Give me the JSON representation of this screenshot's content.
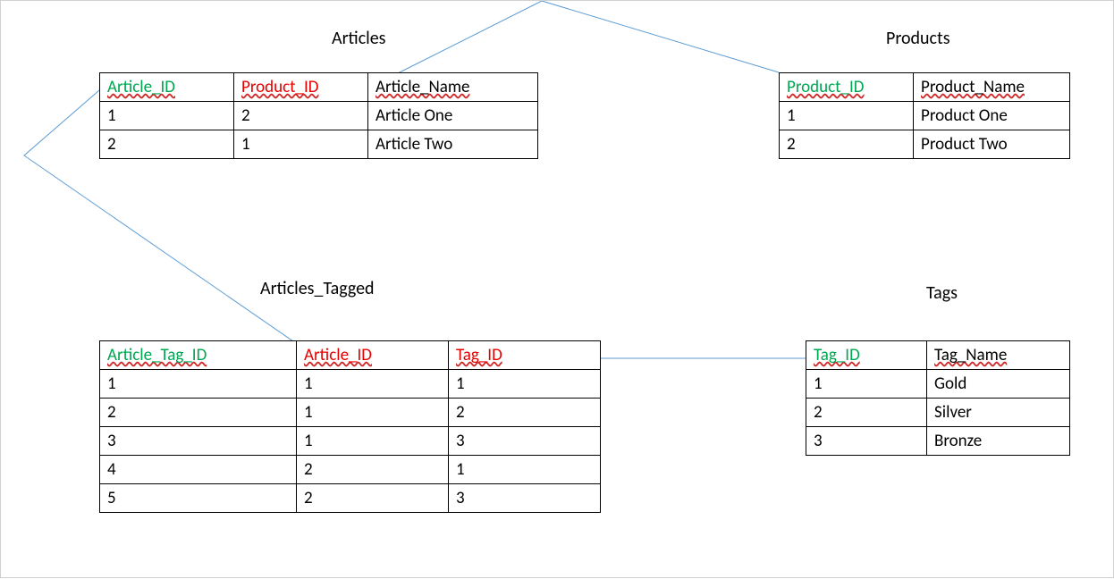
{
  "tables": {
    "articles": {
      "title": "Articles",
      "columns": [
        "Article_ID",
        "Product_ID",
        "Article_Name"
      ],
      "col_roles": [
        "pk",
        "fk",
        "plain_u"
      ],
      "rows": [
        [
          "1",
          "2",
          "Article One"
        ],
        [
          "2",
          "1",
          "Article Two"
        ]
      ]
    },
    "products": {
      "title": "Products",
      "columns": [
        "Product_ID",
        "Product_Name"
      ],
      "col_roles": [
        "pk",
        "plain_u"
      ],
      "rows": [
        [
          "1",
          "Product One"
        ],
        [
          "2",
          "Product Two"
        ]
      ]
    },
    "articles_tagged": {
      "title": "Articles_Tagged",
      "columns": [
        "Article_Tag_ID",
        "Article_ID",
        "Tag_ID"
      ],
      "col_roles": [
        "pk",
        "fk",
        "fk"
      ],
      "rows": [
        [
          "1",
          "1",
          "1"
        ],
        [
          "2",
          "1",
          "2"
        ],
        [
          "3",
          "1",
          "3"
        ],
        [
          "4",
          "2",
          "1"
        ],
        [
          "5",
          "2",
          "3"
        ]
      ]
    },
    "tags": {
      "title": "Tags",
      "columns": [
        "Tag_ID",
        "Tag_Name"
      ],
      "col_roles": [
        "pk",
        "plain_u"
      ],
      "rows": [
        [
          "1",
          "Gold"
        ],
        [
          "2",
          "Silver"
        ],
        [
          "3",
          "Bronze"
        ]
      ]
    }
  },
  "relationships": [
    {
      "from_table": "Articles",
      "from_col": "Product_ID",
      "to_table": "Products",
      "to_col": "Product_ID"
    },
    {
      "from_table": "Articles_Tagged",
      "from_col": "Article_ID",
      "to_table": "Articles",
      "to_col": "Article_ID"
    },
    {
      "from_table": "Articles_Tagged",
      "from_col": "Tag_ID",
      "to_table": "Tags",
      "to_col": "Tag_ID"
    }
  ],
  "colors": {
    "primary_key": "#00a651",
    "foreign_key": "#e60000",
    "arrow": "#5b9bd5",
    "border": "#000000"
  }
}
